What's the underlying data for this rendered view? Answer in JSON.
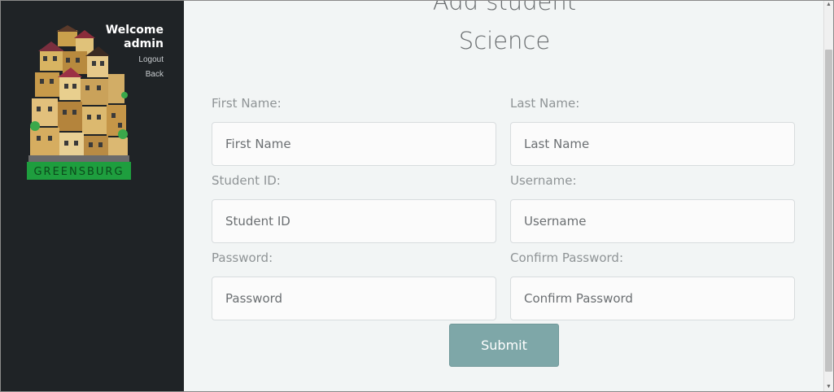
{
  "sidebar": {
    "welcome_line1": "Welcome",
    "welcome_line2": "admin",
    "logout_label": "Logout",
    "back_label": "Back",
    "logo_text": "GREENSBURG"
  },
  "main": {
    "title_line1": "Add student",
    "title_line2": "Science",
    "fields": {
      "first_name": {
        "label": "First Name:",
        "placeholder": "First Name"
      },
      "last_name": {
        "label": "Last Name:",
        "placeholder": "Last Name"
      },
      "student_id": {
        "label": "Student ID:",
        "placeholder": "Student ID"
      },
      "username": {
        "label": "Username:",
        "placeholder": "Username"
      },
      "password": {
        "label": "Password:",
        "placeholder": "Password"
      },
      "confirm_password": {
        "label": "Confirm Password:",
        "placeholder": "Confirm Password"
      }
    },
    "submit_label": "Submit"
  },
  "colors": {
    "sidebar_bg": "#1f2326",
    "main_bg": "#f2f5f5",
    "submit_bg": "#7ea7a8",
    "logo_banner": "#1e9e3e"
  }
}
